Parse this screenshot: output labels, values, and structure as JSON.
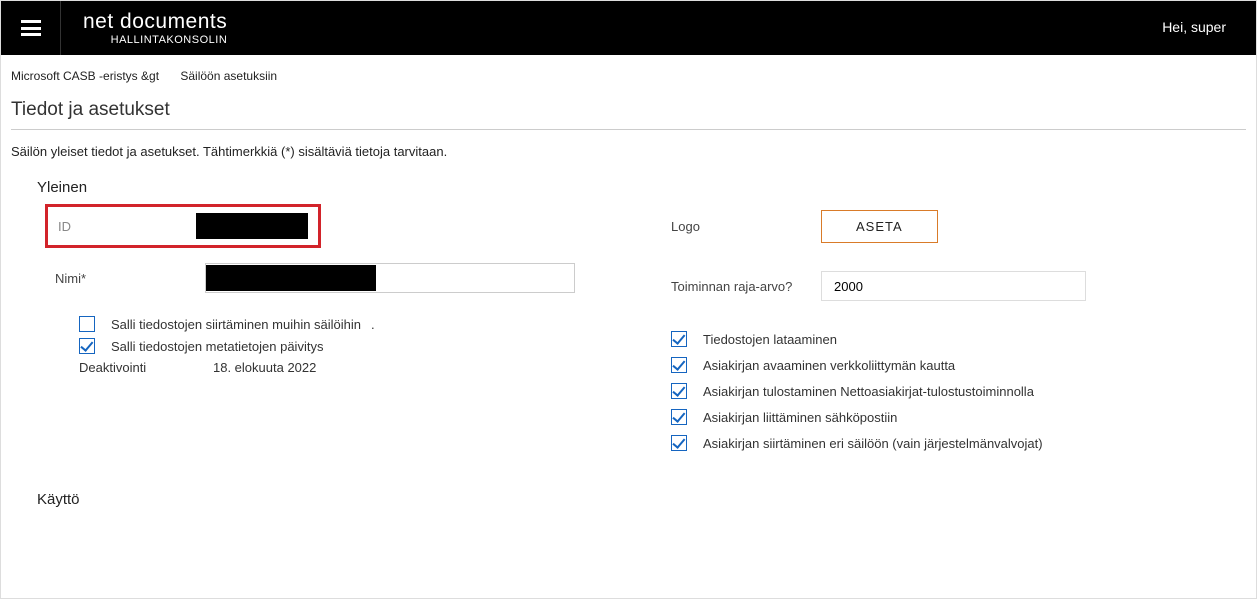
{
  "header": {
    "brand_title": "net documents",
    "brand_sub": "HALLINTAKONSOLIN",
    "greeting": "Hei, super"
  },
  "breadcrumb": {
    "item1": "Microsoft CASB -eristys &gt",
    "item2": "Säilöön asetuksiin"
  },
  "page": {
    "title": "Tiedot ja asetukset",
    "desc": "Säilön yleiset tiedot ja asetukset. Tähtimerkkiä (*) sisältäviä tietoja tarvitaan."
  },
  "section_general": "Yleinen",
  "section_usage": "Käyttö",
  "left": {
    "id_label": "ID",
    "name_label": "Nimi*",
    "allow_move_label": "Salli tiedostojen siirtäminen muihin säilöihin",
    "allow_meta_label": "Salli tiedostojen metatietojen päivitys",
    "deact_label": "Deaktivointi",
    "deact_value": "18. elokuuta 2022"
  },
  "right": {
    "logo_label": "Logo",
    "logo_button": "ASETA",
    "limit_label": "Toiminnan raja-arvo?",
    "limit_value": "2000",
    "checks": {
      "c1": "Tiedostojen lataaminen",
      "c2": "Asiakirjan avaaminen verkkoliittymän kautta",
      "c3": "Asiakirjan tulostaminen Nettoasiakirjat-tulostustoiminnolla",
      "c4": "Asiakirjan liittäminen sähköpostiin",
      "c5": "Asiakirjan siirtäminen eri säilöön (vain järjestelmänvalvojat)"
    }
  }
}
